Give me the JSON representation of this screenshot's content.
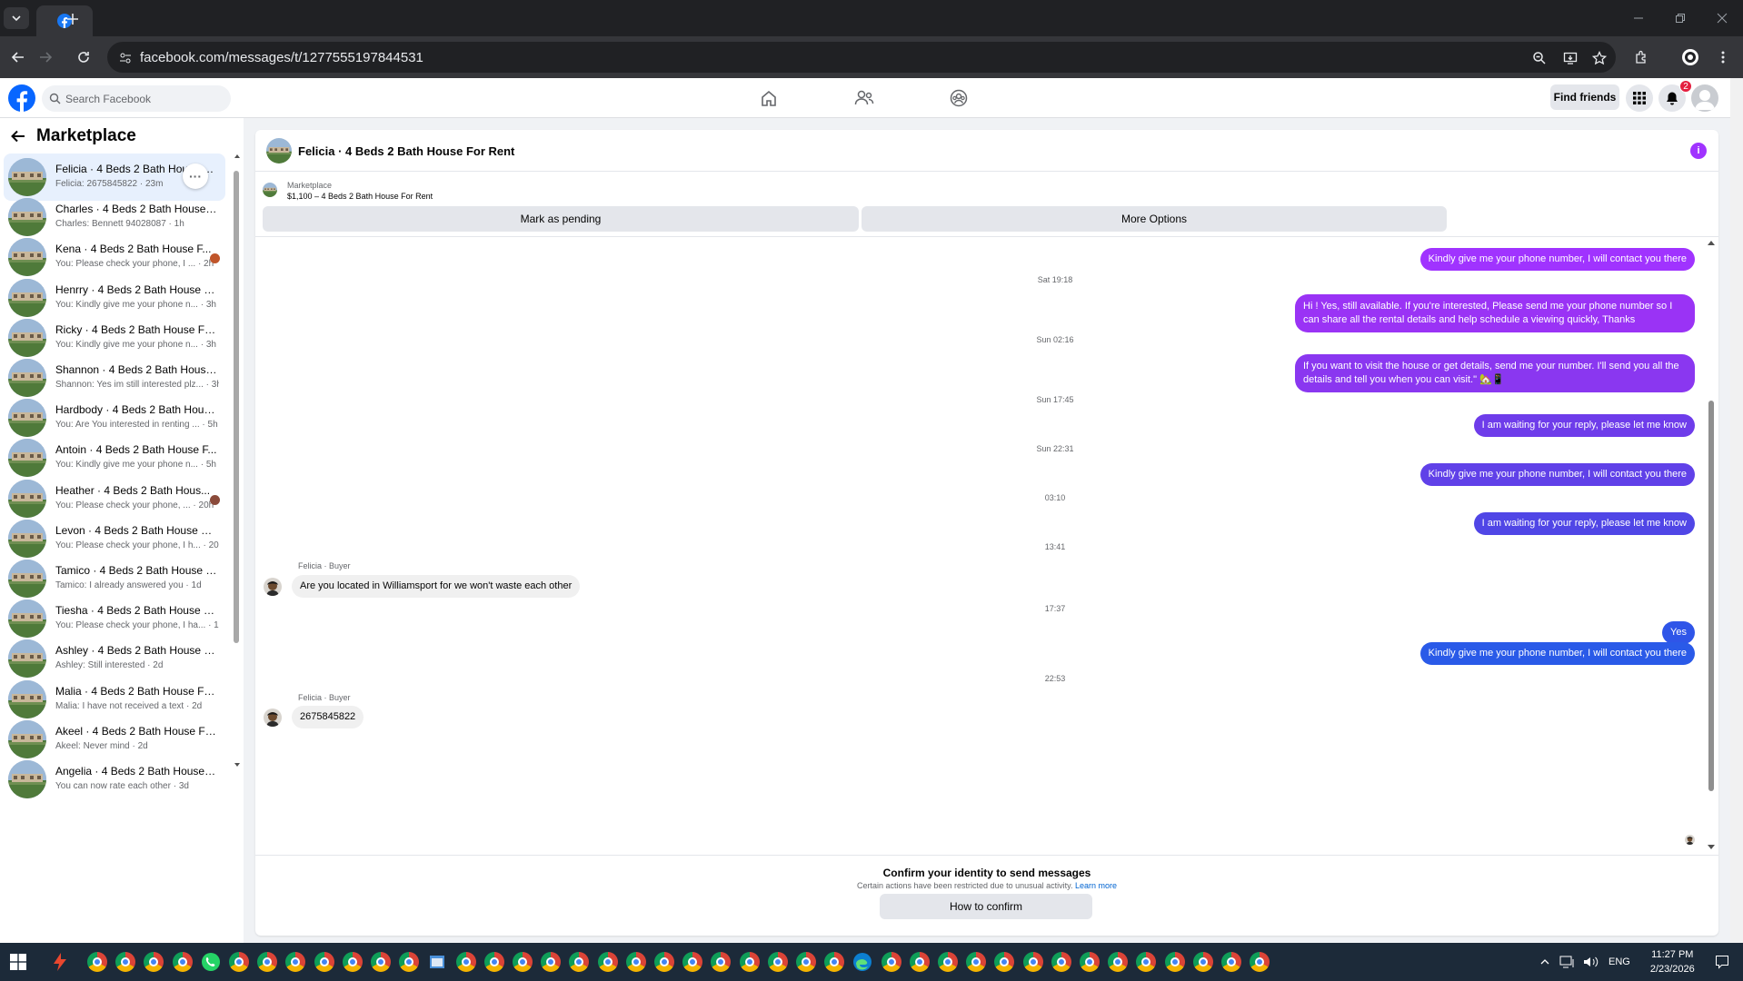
{
  "browser": {
    "url": "facebook.com/messages/t/1277555197844531"
  },
  "fb": {
    "search_placeholder": "Search Facebook",
    "find_friends": "Find friends",
    "notifications_count": "2"
  },
  "sidebar": {
    "title": "Marketplace",
    "conversations": [
      {
        "name": "Felicia · 4 Beds 2 Bath House For Rent",
        "preview": "Felicia: 2675845822 · 23m",
        "active": true
      },
      {
        "name": "Charles · 4 Beds 2 Bath House F...",
        "preview": "Charles: Bennett 94028087 · 1h"
      },
      {
        "name": "Kena · 4 Beds 2 Bath House F...",
        "preview": "You: Please check your phone, I ... · 2h",
        "dot": "#c0552a"
      },
      {
        "name": "Henrry · 4 Beds 2 Bath House F...",
        "preview": "You: Kindly give me your phone n... · 3h"
      },
      {
        "name": "Ricky · 4 Beds 2 Bath House For...",
        "preview": "You: Kindly give me your phone n... · 3h"
      },
      {
        "name": "Shannon · 4 Beds 2 Bath House...",
        "preview": "Shannon: Yes im still interested plz... · 3h"
      },
      {
        "name": "Hardbody · 4 Beds 2 Bath Hous...",
        "preview": "You: Are You interested in renting ... · 5h"
      },
      {
        "name": "Antoin · 4 Beds 2 Bath House F...",
        "preview": "You: Kindly give me your phone n... · 5h"
      },
      {
        "name": "Heather · 4 Beds 2 Bath Hous...",
        "preview": "You: Please check your phone, ... · 20h",
        "dot": "#8a4a3a"
      },
      {
        "name": "Levon · 4 Beds 2 Bath House Fo...",
        "preview": "You: Please check your phone, I h... · 20h"
      },
      {
        "name": "Tamico · 4 Beds 2 Bath House F...",
        "preview": "Tamico: I already answered you · 1d"
      },
      {
        "name": "Tiesha · 4 Beds 2 Bath House F...",
        "preview": "You: Please check your phone, I ha... · 1d"
      },
      {
        "name": "Ashley · 4 Beds 2 Bath House F...",
        "preview": "Ashley: Still interested · 2d"
      },
      {
        "name": "Malia · 4 Beds 2 Bath House For...",
        "preview": "Malia: I have not received a text · 2d"
      },
      {
        "name": "Akeel · 4 Beds 2 Bath House For...",
        "preview": "Akeel: Never mind · 2d"
      },
      {
        "name": "Angelia · 4 Beds 2 Bath House F...",
        "preview": "You can now rate each other · 3d"
      }
    ]
  },
  "chat": {
    "title": "Felicia · 4 Beds 2 Bath House For Rent",
    "listing_label": "Marketplace",
    "listing_detail": "$1,100 – 4 Beds 2 Bath House For Rent",
    "mark_pending": "Mark as pending",
    "more_options": "More Options",
    "messages": [
      {
        "kind": "out",
        "text": "Kindly give me your phone number, I will contact you there",
        "color": "#a033ff"
      },
      {
        "kind": "ts",
        "text": "Sat 19:18"
      },
      {
        "kind": "out",
        "text": "Hi ! Yes, still available. If you're interested, Please send me your phone number so I can share all the rental details and help schedule a viewing quickly, Thanks",
        "color": "#9a33f5"
      },
      {
        "kind": "ts",
        "text": "Sun 02:16"
      },
      {
        "kind": "out",
        "text": "If you want to visit the house or get details, send me your number. I'll send you all the details and tell you when you can visit.\" 🏡📱",
        "color": "#8a37f0"
      },
      {
        "kind": "ts",
        "text": "Sun 17:45"
      },
      {
        "kind": "out",
        "text": "I am waiting for your reply, please let me know",
        "color": "#6e3cea"
      },
      {
        "kind": "ts",
        "text": "Sun 22:31"
      },
      {
        "kind": "out",
        "text": "Kindly give me your phone number, I will contact you there",
        "color": "#6041e8"
      },
      {
        "kind": "ts",
        "text": "03:10"
      },
      {
        "kind": "out",
        "text": "I am waiting for your reply, please let me know",
        "color": "#5046e6"
      },
      {
        "kind": "ts",
        "text": "13:41"
      },
      {
        "kind": "sender",
        "text": "Felicia · Buyer"
      },
      {
        "kind": "in",
        "text": "Are you located in Williamsport for we won't waste each other"
      },
      {
        "kind": "ts",
        "text": "17:37"
      },
      {
        "kind": "out",
        "text": "Yes",
        "color": "#2f55e8"
      },
      {
        "kind": "out",
        "text": "Kindly give me your phone number, I will contact you there",
        "color": "#2a5ae8"
      },
      {
        "kind": "ts",
        "text": "22:53"
      },
      {
        "kind": "sender",
        "text": "Felicia · Buyer"
      },
      {
        "kind": "in",
        "text": "2675845822"
      }
    ],
    "footer_title": "Confirm your identity to send messages",
    "footer_text": "Certain actions have been restricted due to unusual activity.",
    "footer_link": "Learn more",
    "confirm_button": "How to confirm"
  },
  "taskbar": {
    "lang": "ENG",
    "time": "11:27 PM",
    "date": "2/23/2026"
  }
}
